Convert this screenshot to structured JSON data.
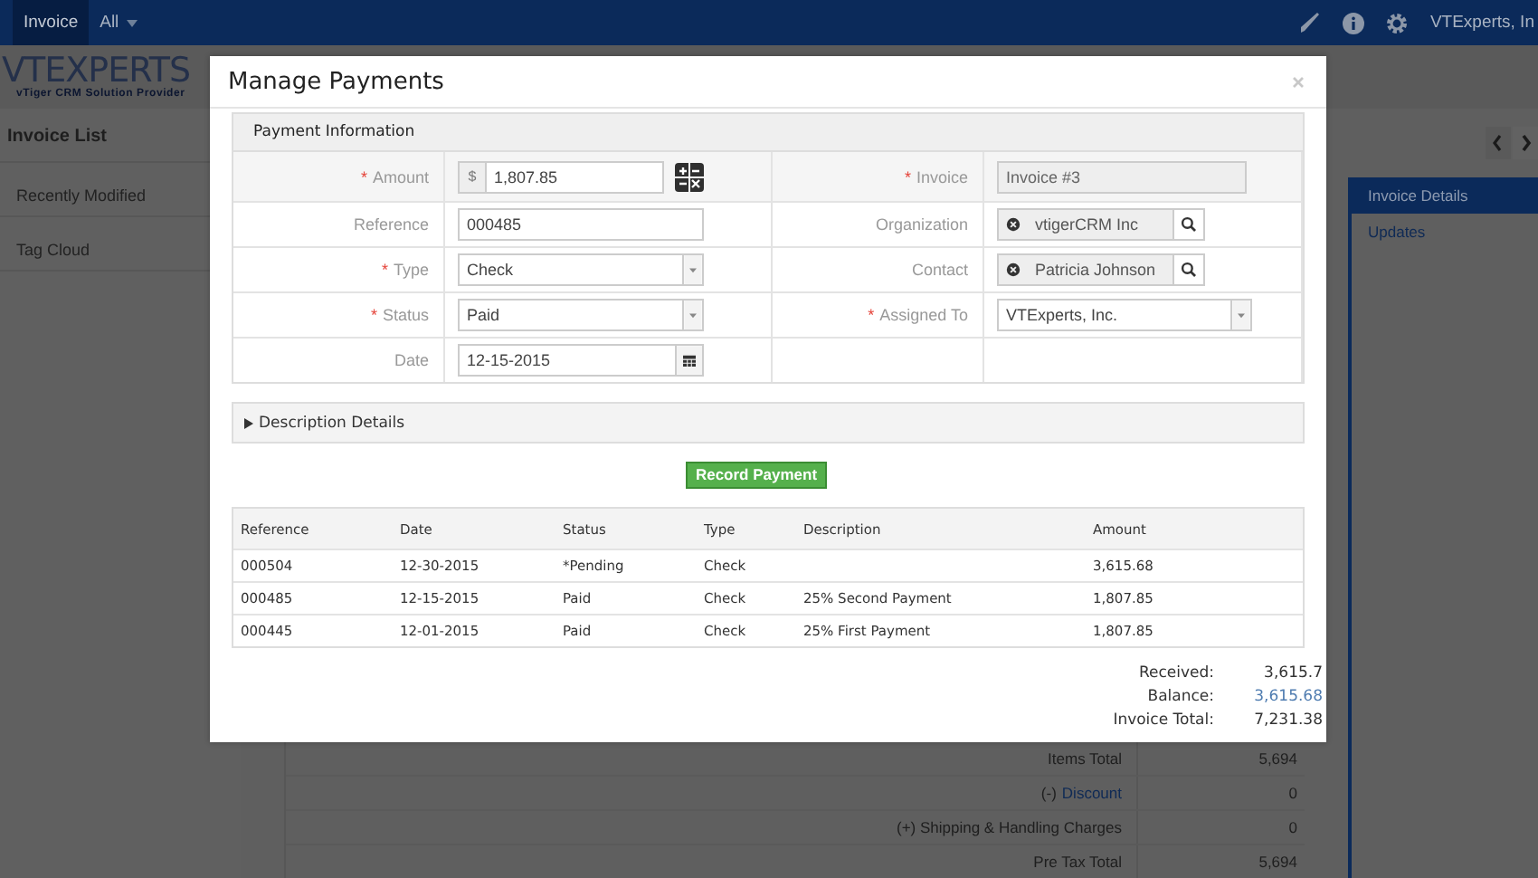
{
  "top_bar": {
    "tabs": [
      {
        "label": "Invoice",
        "selected": true
      },
      {
        "label": "All",
        "selected": false
      }
    ],
    "user": "VTExperts, In"
  },
  "logo": {
    "name": "VTEXPERTS",
    "tagline": "vTiger CRM Solution Provider"
  },
  "sidebar": {
    "title": "Invoice List",
    "items": [
      "Recently Modified",
      "Tag Cloud"
    ]
  },
  "right_panel": {
    "items": [
      {
        "label": "Invoice Details",
        "selected": true
      },
      {
        "label": "Updates",
        "selected": false
      }
    ]
  },
  "totals_table": {
    "rows": [
      {
        "prefix": "",
        "label": "Items Total",
        "value": "5,694"
      },
      {
        "prefix": "(-)",
        "label": "Discount",
        "value": "0"
      },
      {
        "prefix": "(+)",
        "label": "Shipping & Handling Charges",
        "value": "0"
      },
      {
        "prefix": "",
        "label": "Pre Tax Total",
        "value": "5,694"
      }
    ]
  },
  "modal": {
    "title": "Manage Payments",
    "payment_information": {
      "title": "Payment Information",
      "required_mark": "*",
      "fields": [
        {
          "label": "Amount",
          "required": true,
          "kind": "currency",
          "prefix": "$",
          "value": "1,807.85"
        },
        {
          "label": "Invoice",
          "required": true,
          "kind": "readonly",
          "value": "Invoice #3"
        },
        {
          "label": "Reference",
          "required": false,
          "kind": "text",
          "value": "000485"
        },
        {
          "label": "Organization",
          "required": false,
          "kind": "lookup",
          "value": "vtigerCRM Inc"
        },
        {
          "label": "Type",
          "required": true,
          "kind": "select",
          "value": "Check"
        },
        {
          "label": "Contact",
          "required": false,
          "kind": "lookup",
          "value": "Patricia Johnson"
        },
        {
          "label": "Status",
          "required": true,
          "kind": "select",
          "value": "Paid"
        },
        {
          "label": "Assigned To",
          "required": true,
          "kind": "select",
          "value": "VTExperts, Inc."
        },
        {
          "label": "Date",
          "required": false,
          "kind": "date",
          "value": "12-15-2015"
        }
      ]
    },
    "description_details": {
      "title": "Description Details",
      "expanded": false
    },
    "record_button": "Record Payment",
    "payments": {
      "columns": [
        "Reference",
        "Date",
        "Status",
        "Type",
        "Description",
        "Amount"
      ],
      "rows": [
        [
          "000504",
          "12-30-2015",
          "*Pending",
          "Check",
          "",
          "3,615.68"
        ],
        [
          "000485",
          "12-15-2015",
          "Paid",
          "Check",
          "25% Second Payment",
          "1,807.85"
        ],
        [
          "000445",
          "12-01-2015",
          "Paid",
          "Check",
          "25% First Payment",
          "1,807.85"
        ]
      ]
    },
    "summary": [
      {
        "label": "Received:",
        "value": "3,615.7",
        "link": false
      },
      {
        "label": "Balance:",
        "value": "3,615.68",
        "link": true
      },
      {
        "label": "Invoice Total:",
        "value": "7,231.38",
        "link": false
      }
    ]
  }
}
